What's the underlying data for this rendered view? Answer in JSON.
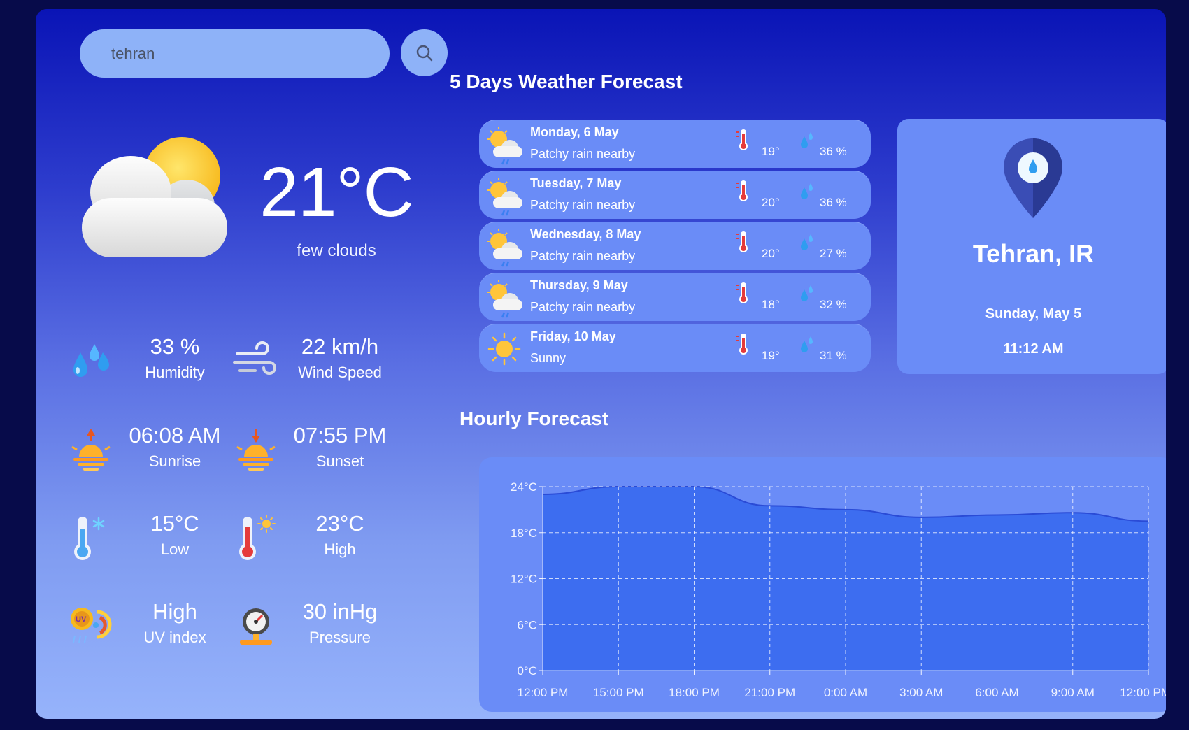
{
  "search": {
    "value": "tehran",
    "placeholder": ""
  },
  "current": {
    "temp": "21°C",
    "description": "few clouds",
    "icon": "sun-cloud-icon"
  },
  "stats": [
    {
      "value": "33 %",
      "label": "Humidity",
      "icon": "humidity-icon"
    },
    {
      "value": "22 km/h",
      "label": "Wind Speed",
      "icon": "wind-icon"
    },
    {
      "value": "06:08 AM",
      "label": "Sunrise",
      "icon": "sunrise-icon"
    },
    {
      "value": "07:55 PM",
      "label": "Sunset",
      "icon": "sunset-icon"
    },
    {
      "value": "15°C",
      "label": "Low",
      "icon": "thermometer-cold-icon"
    },
    {
      "value": "23°C",
      "label": "High",
      "icon": "thermometer-hot-icon"
    },
    {
      "value": "High",
      "label": "UV index",
      "icon": "uv-index-icon"
    },
    {
      "value": "30 inHg",
      "label": "Pressure",
      "icon": "pressure-gauge-icon"
    }
  ],
  "forecast": {
    "title": "5 Days Weather Forecast",
    "days": [
      {
        "day": "Monday, 6 May",
        "condition": "Patchy rain nearby",
        "temp": "19°",
        "humidity": "36 %",
        "icon": "sun-cloud-rain-icon"
      },
      {
        "day": "Tuesday, 7 May",
        "condition": "Patchy rain nearby",
        "temp": "20°",
        "humidity": "36 %",
        "icon": "sun-cloud-rain-icon"
      },
      {
        "day": "Wednesday, 8 May",
        "condition": "Patchy rain nearby",
        "temp": "20°",
        "humidity": "27 %",
        "icon": "sun-cloud-rain-icon"
      },
      {
        "day": "Thursday, 9 May",
        "condition": "Patchy rain nearby",
        "temp": "18°",
        "humidity": "32 %",
        "icon": "sun-cloud-rain-icon"
      },
      {
        "day": "Friday, 10 May",
        "condition": "Sunny",
        "temp": "19°",
        "humidity": "31 %",
        "icon": "sun-icon"
      }
    ]
  },
  "location": {
    "city": "Tehran, IR",
    "date": "Sunday, May 5",
    "time": "11:12 AM",
    "icon": "location-pin-icon"
  },
  "hourly": {
    "title": "Hourly Forecast"
  },
  "colors": {
    "accent": "#6a8cf7",
    "chart_fill": "#3d6df0",
    "chart_line": "#2a4bd6",
    "card_top": "#0a14b6",
    "card_bottom": "#96b3fb"
  },
  "chart_data": {
    "type": "area",
    "x": [
      "12:00 PM",
      "15:00 PM",
      "18:00 PM",
      "21:00 PM",
      "0:00 AM",
      "3:00 AM",
      "6:00 AM",
      "9:00 AM",
      "12:00 PM"
    ],
    "values": [
      23,
      24,
      24,
      21.5,
      21,
      20,
      20.3,
      20.6,
      19.5
    ],
    "yticks": [
      "0°C",
      "6°C",
      "12°C",
      "18°C",
      "24°C"
    ],
    "ylim": [
      0,
      24
    ],
    "grid": true,
    "title": "",
    "xlabel": "",
    "ylabel": ""
  }
}
